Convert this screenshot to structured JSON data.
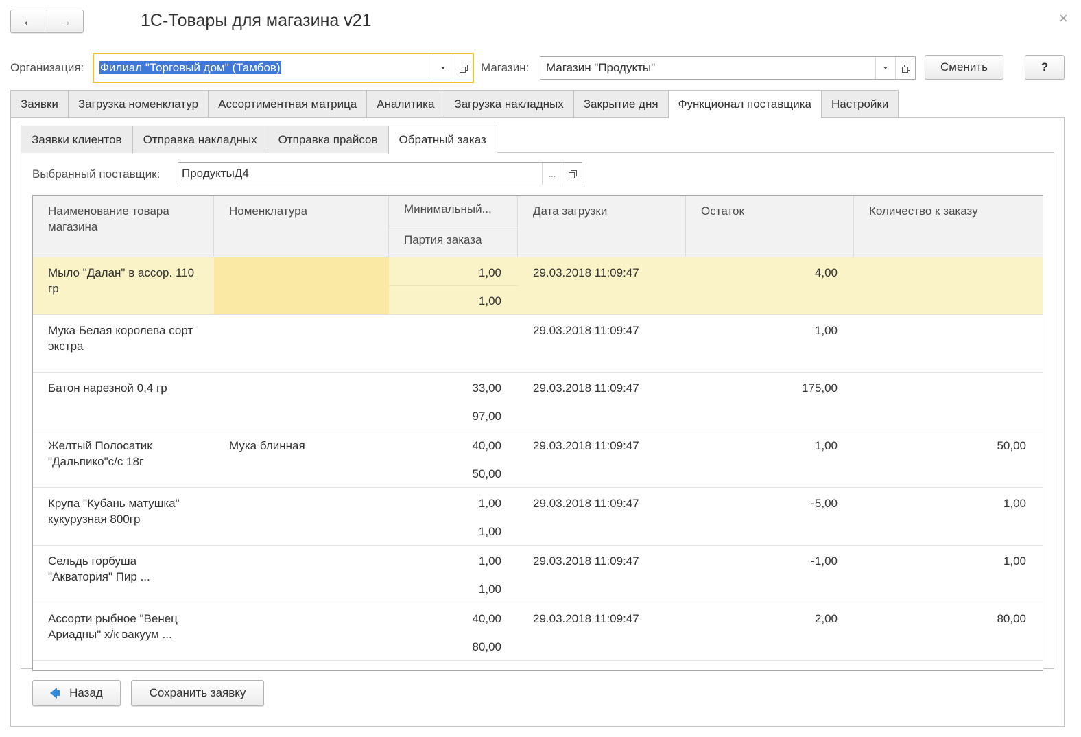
{
  "window": {
    "title": "1С-Товары для магазина v21",
    "back_glyph": "←",
    "forward_glyph": "→",
    "close_glyph": "×"
  },
  "header": {
    "org_label": "Организация:",
    "org_value": "Филиал \"Торговый дом\" (Тамбов)",
    "shop_label": "Магазин:",
    "shop_value": "Магазин \"Продукты\"",
    "change_button": "Сменить",
    "help_button": "?"
  },
  "main_tabs": [
    {
      "label": "Заявки",
      "active": false
    },
    {
      "label": "Загрузка номенклатур",
      "active": false
    },
    {
      "label": "Ассортиментная матрица",
      "active": false
    },
    {
      "label": "Аналитика",
      "active": false
    },
    {
      "label": "Загрузка накладных",
      "active": false
    },
    {
      "label": "Закрытие дня",
      "active": false
    },
    {
      "label": "Функционал поставщика",
      "active": true
    },
    {
      "label": "Настройки",
      "active": false
    }
  ],
  "sub_tabs": [
    {
      "label": "Заявки клиентов",
      "active": false
    },
    {
      "label": "Отправка накладных",
      "active": false
    },
    {
      "label": "Отправка прайсов",
      "active": false
    },
    {
      "label": "Обратный заказ",
      "active": true
    }
  ],
  "supplier": {
    "label": "Выбранный поставщик:",
    "value": "ПродуктыД4",
    "dots": "..."
  },
  "table": {
    "columns": {
      "name": "Наименование товара магазина",
      "nomenclature": "Номенклатура",
      "minimal": "Минимальный...",
      "batch": "Партия заказа",
      "date": "Дата загрузки",
      "remainder": "Остаток",
      "order_qty": "Количество к заказу"
    },
    "rows": [
      {
        "name": " Мыло \"Далан\" в ассор. 110 гр",
        "nomenclature": "",
        "minimal": "1,00",
        "batch": "1,00",
        "date": "29.03.2018 11:09:47",
        "remainder": "4,00",
        "order_qty": "",
        "selected": true
      },
      {
        "name": "Мука Белая королева сорт экстра",
        "nomenclature": "",
        "minimal": "",
        "batch": "",
        "date": "29.03.2018 11:09:47",
        "remainder": "1,00",
        "order_qty": "",
        "selected": false
      },
      {
        "name": "Батон нарезной 0,4 гр",
        "nomenclature": "",
        "minimal": "33,00",
        "batch": "97,00",
        "date": "29.03.2018 11:09:47",
        "remainder": "175,00",
        "order_qty": "",
        "selected": false
      },
      {
        "name": "Желтый Полосатик \"Дальпико\"с/с 18г",
        "nomenclature": "Мука блинная",
        "minimal": "40,00",
        "batch": "50,00",
        "date": "29.03.2018 11:09:47",
        "remainder": "1,00",
        "order_qty": "50,00",
        "selected": false
      },
      {
        "name": "Крупа \"Кубань матушка\" кукурузная 800гр",
        "nomenclature": "",
        "minimal": "1,00",
        "batch": "1,00",
        "date": "29.03.2018 11:09:47",
        "remainder": "-5,00",
        "order_qty": "1,00",
        "selected": false
      },
      {
        "name": "Сельдь горбуша \"Акватория\" Пир ...",
        "nomenclature": "",
        "minimal": "1,00",
        "batch": "1,00",
        "date": "29.03.2018 11:09:47",
        "remainder": "-1,00",
        "order_qty": "1,00",
        "selected": false
      },
      {
        "name": "Ассорти рыбное \"Венец Ариадны\" х/к вакуум ...",
        "nomenclature": "",
        "minimal": "40,00",
        "batch": "80,00",
        "date": "29.03.2018 11:09:47",
        "remainder": "2,00",
        "order_qty": "80,00",
        "selected": false
      }
    ]
  },
  "footer": {
    "back_button": "Назад",
    "save_button": "Сохранить заявку"
  },
  "colors": {
    "focus_border": "#f2c130",
    "selection_blue": "#3f78d8",
    "selected_row": "#fbf3c8",
    "back_arrow": "#2f8ad8"
  }
}
